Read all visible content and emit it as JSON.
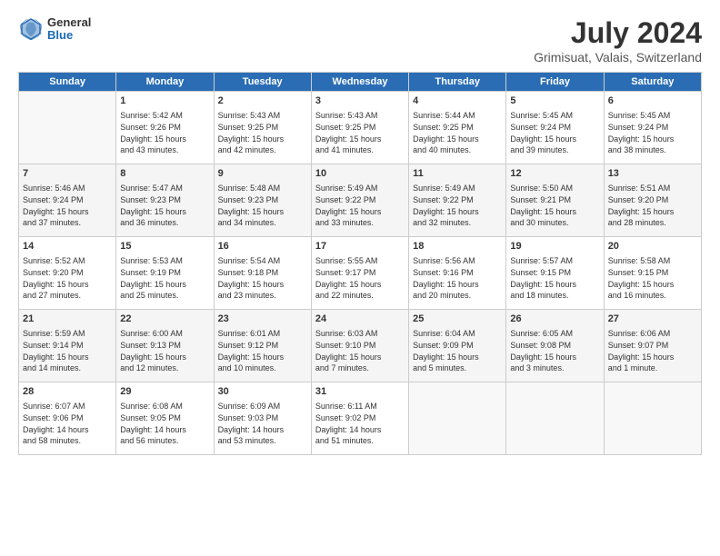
{
  "header": {
    "logo_general": "General",
    "logo_blue": "Blue",
    "title": "July 2024",
    "location": "Grimisuat, Valais, Switzerland"
  },
  "days_of_week": [
    "Sunday",
    "Monday",
    "Tuesday",
    "Wednesday",
    "Thursday",
    "Friday",
    "Saturday"
  ],
  "weeks": [
    [
      {
        "day": "",
        "data": ""
      },
      {
        "day": "1",
        "data": "Sunrise: 5:42 AM\nSunset: 9:26 PM\nDaylight: 15 hours\nand 43 minutes."
      },
      {
        "day": "2",
        "data": "Sunrise: 5:43 AM\nSunset: 9:25 PM\nDaylight: 15 hours\nand 42 minutes."
      },
      {
        "day": "3",
        "data": "Sunrise: 5:43 AM\nSunset: 9:25 PM\nDaylight: 15 hours\nand 41 minutes."
      },
      {
        "day": "4",
        "data": "Sunrise: 5:44 AM\nSunset: 9:25 PM\nDaylight: 15 hours\nand 40 minutes."
      },
      {
        "day": "5",
        "data": "Sunrise: 5:45 AM\nSunset: 9:24 PM\nDaylight: 15 hours\nand 39 minutes."
      },
      {
        "day": "6",
        "data": "Sunrise: 5:45 AM\nSunset: 9:24 PM\nDaylight: 15 hours\nand 38 minutes."
      }
    ],
    [
      {
        "day": "7",
        "data": "Sunrise: 5:46 AM\nSunset: 9:24 PM\nDaylight: 15 hours\nand 37 minutes."
      },
      {
        "day": "8",
        "data": "Sunrise: 5:47 AM\nSunset: 9:23 PM\nDaylight: 15 hours\nand 36 minutes."
      },
      {
        "day": "9",
        "data": "Sunrise: 5:48 AM\nSunset: 9:23 PM\nDaylight: 15 hours\nand 34 minutes."
      },
      {
        "day": "10",
        "data": "Sunrise: 5:49 AM\nSunset: 9:22 PM\nDaylight: 15 hours\nand 33 minutes."
      },
      {
        "day": "11",
        "data": "Sunrise: 5:49 AM\nSunset: 9:22 PM\nDaylight: 15 hours\nand 32 minutes."
      },
      {
        "day": "12",
        "data": "Sunrise: 5:50 AM\nSunset: 9:21 PM\nDaylight: 15 hours\nand 30 minutes."
      },
      {
        "day": "13",
        "data": "Sunrise: 5:51 AM\nSunset: 9:20 PM\nDaylight: 15 hours\nand 28 minutes."
      }
    ],
    [
      {
        "day": "14",
        "data": "Sunrise: 5:52 AM\nSunset: 9:20 PM\nDaylight: 15 hours\nand 27 minutes."
      },
      {
        "day": "15",
        "data": "Sunrise: 5:53 AM\nSunset: 9:19 PM\nDaylight: 15 hours\nand 25 minutes."
      },
      {
        "day": "16",
        "data": "Sunrise: 5:54 AM\nSunset: 9:18 PM\nDaylight: 15 hours\nand 23 minutes."
      },
      {
        "day": "17",
        "data": "Sunrise: 5:55 AM\nSunset: 9:17 PM\nDaylight: 15 hours\nand 22 minutes."
      },
      {
        "day": "18",
        "data": "Sunrise: 5:56 AM\nSunset: 9:16 PM\nDaylight: 15 hours\nand 20 minutes."
      },
      {
        "day": "19",
        "data": "Sunrise: 5:57 AM\nSunset: 9:15 PM\nDaylight: 15 hours\nand 18 minutes."
      },
      {
        "day": "20",
        "data": "Sunrise: 5:58 AM\nSunset: 9:15 PM\nDaylight: 15 hours\nand 16 minutes."
      }
    ],
    [
      {
        "day": "21",
        "data": "Sunrise: 5:59 AM\nSunset: 9:14 PM\nDaylight: 15 hours\nand 14 minutes."
      },
      {
        "day": "22",
        "data": "Sunrise: 6:00 AM\nSunset: 9:13 PM\nDaylight: 15 hours\nand 12 minutes."
      },
      {
        "day": "23",
        "data": "Sunrise: 6:01 AM\nSunset: 9:12 PM\nDaylight: 15 hours\nand 10 minutes."
      },
      {
        "day": "24",
        "data": "Sunrise: 6:03 AM\nSunset: 9:10 PM\nDaylight: 15 hours\nand 7 minutes."
      },
      {
        "day": "25",
        "data": "Sunrise: 6:04 AM\nSunset: 9:09 PM\nDaylight: 15 hours\nand 5 minutes."
      },
      {
        "day": "26",
        "data": "Sunrise: 6:05 AM\nSunset: 9:08 PM\nDaylight: 15 hours\nand 3 minutes."
      },
      {
        "day": "27",
        "data": "Sunrise: 6:06 AM\nSunset: 9:07 PM\nDaylight: 15 hours\nand 1 minute."
      }
    ],
    [
      {
        "day": "28",
        "data": "Sunrise: 6:07 AM\nSunset: 9:06 PM\nDaylight: 14 hours\nand 58 minutes."
      },
      {
        "day": "29",
        "data": "Sunrise: 6:08 AM\nSunset: 9:05 PM\nDaylight: 14 hours\nand 56 minutes."
      },
      {
        "day": "30",
        "data": "Sunrise: 6:09 AM\nSunset: 9:03 PM\nDaylight: 14 hours\nand 53 minutes."
      },
      {
        "day": "31",
        "data": "Sunrise: 6:11 AM\nSunset: 9:02 PM\nDaylight: 14 hours\nand 51 minutes."
      },
      {
        "day": "",
        "data": ""
      },
      {
        "day": "",
        "data": ""
      },
      {
        "day": "",
        "data": ""
      }
    ]
  ]
}
